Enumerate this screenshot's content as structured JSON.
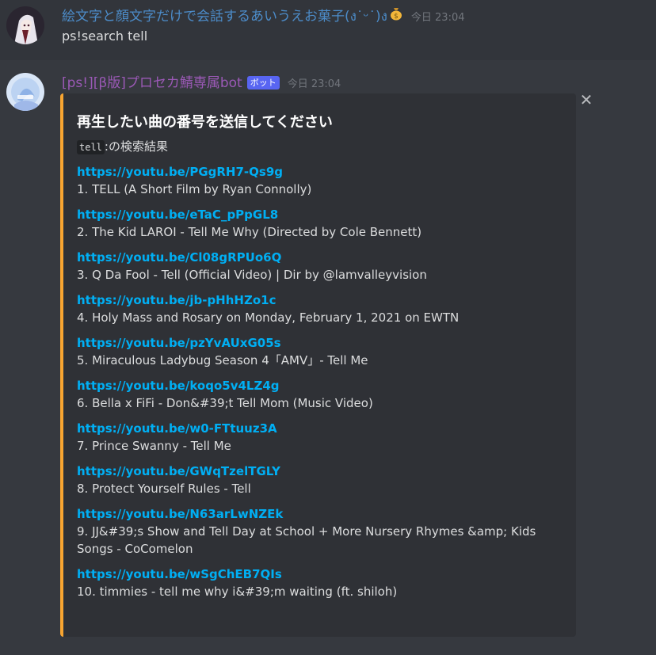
{
  "messages": [
    {
      "username": "絵文字と顔文字だけで会話するあいうえお菓子(ง˙ᵕ˙)ง",
      "username_emoji": "money-bag",
      "timestamp": "今日 23:04",
      "content": "ps!search tell"
    },
    {
      "username": "[ps!][β版]プロセカ鯖専属bot",
      "bot_tag": "ボット",
      "timestamp": "今日 23:04"
    }
  ],
  "embed": {
    "accent_color": "#f8a531",
    "title": "再生したい曲の番号を送信してください",
    "query_code": "tell",
    "query_suffix": ":の検索結果",
    "close_icon": "close-icon",
    "results": [
      {
        "url": "https://youtu.be/PGgRH7-Qs9g",
        "title": "1. TELL (A Short Film by Ryan Connolly)"
      },
      {
        "url": "https://youtu.be/eTaC_pPpGL8",
        "title": "2. The Kid LAROI - Tell Me Why (Directed by Cole Bennett)"
      },
      {
        "url": "https://youtu.be/Cl08gRPUo6Q",
        "title": "3. Q Da Fool - Tell (Official Video) | Dir by @lamvalleyvision"
      },
      {
        "url": "https://youtu.be/jb-pHhHZo1c",
        "title": "4. Holy Mass and Rosary on Monday, February 1, 2021 on EWTN"
      },
      {
        "url": "https://youtu.be/pzYvAUxG05s",
        "title": "5. Miraculous Ladybug Season 4「AMV」- Tell Me"
      },
      {
        "url": "https://youtu.be/koqo5v4LZ4g",
        "title": "6. Bella x FiFi - Don&#39;t Tell Mom (Music Video)"
      },
      {
        "url": "https://youtu.be/w0-FTtuuz3A",
        "title": "7. Prince Swanny - Tell Me"
      },
      {
        "url": "https://youtu.be/GWqTzelTGLY",
        "title": "8. Protect Yourself Rules - Tell"
      },
      {
        "url": "https://youtu.be/N63arLwNZEk",
        "title": "9. JJ&#39;s Show and Tell Day at School + More Nursery Rhymes &amp; Kids Songs - CoComelon"
      },
      {
        "url": "https://youtu.be/wSgChEB7QIs",
        "title": "10. timmies - tell me why i&#39;m waiting (ft. shiloh)"
      }
    ]
  }
}
